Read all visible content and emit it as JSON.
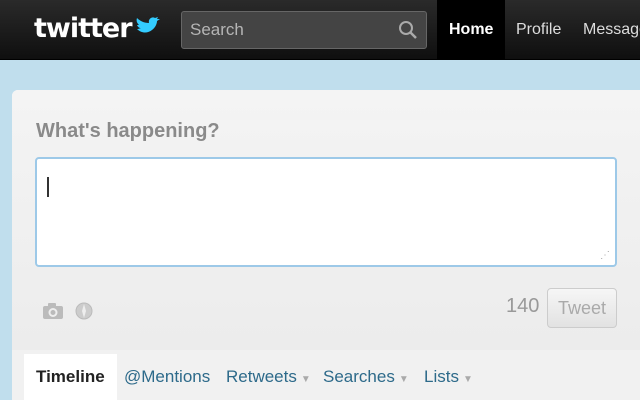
{
  "topbar": {
    "logo_text": "twitter",
    "search": {
      "placeholder": "Search",
      "value": ""
    },
    "nav": [
      {
        "label": "Home",
        "active": true
      },
      {
        "label": "Profile",
        "active": false
      },
      {
        "label": "Messages",
        "active": false
      }
    ]
  },
  "compose": {
    "prompt": "What's happening?",
    "text": "",
    "char_count": "140",
    "tweet_label": "Tweet"
  },
  "tabs": [
    {
      "label": "Timeline",
      "active": true,
      "dropdown": false
    },
    {
      "label": "@Mentions",
      "active": false,
      "dropdown": false
    },
    {
      "label": "Retweets",
      "active": false,
      "dropdown": true
    },
    {
      "label": "Searches",
      "active": false,
      "dropdown": true
    },
    {
      "label": "Lists",
      "active": false,
      "dropdown": true
    }
  ],
  "colors": {
    "background": "#c0deed",
    "topbar": "#1a1a1a",
    "link": "#2d6a8a",
    "input_border": "#9dc9e8",
    "logo_bird": "#33ccff"
  }
}
